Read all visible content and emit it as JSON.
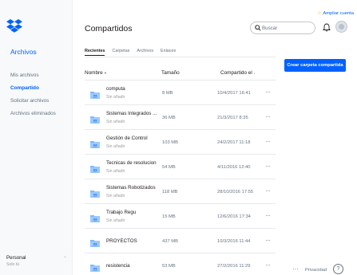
{
  "sidebar": {
    "title": "Archivos",
    "items": [
      {
        "label": "Mis archivos"
      },
      {
        "label": "Compartido"
      },
      {
        "label": "Solicitar archivos"
      },
      {
        "label": "Archivos eliminados"
      }
    ],
    "account": {
      "name": "Personal",
      "sub": "Solo tú"
    }
  },
  "header": {
    "title": "Compartidos",
    "upgrade_label": "Ampliar cuenta",
    "search_placeholder": "Buscar"
  },
  "tabs": [
    {
      "label": "Recientes",
      "active": true
    },
    {
      "label": "Carpetas"
    },
    {
      "label": "Archivos"
    },
    {
      "label": "Enlaces"
    }
  ],
  "create_button": "Crear carpeta compartida",
  "table": {
    "columns": {
      "name": "Nombre",
      "name_sort": "▾",
      "size": "Tamaño",
      "shared": "Compartido el",
      "shared_sort": "↓"
    },
    "rows": [
      {
        "name": "computa",
        "sub": "Sin añadir",
        "size": "8 MB",
        "date": "10/4/2017 16:41"
      },
      {
        "name": "Sistemas Integrados ...",
        "sub": "Sin añadir",
        "size": "36 MB",
        "date": "21/3/2017 8:35"
      },
      {
        "name": "Gestión de Control",
        "sub": "Sin añadir",
        "size": "103 MB",
        "date": "24/2/2017 11:18"
      },
      {
        "name": "Tecnicas de resolucion",
        "sub": "Sin añadir",
        "size": "54 MB",
        "date": "4/11/2016 12:40"
      },
      {
        "name": "Sistemas Robotizados",
        "sub": "Sin añadir",
        "size": "118 MB",
        "date": "28/10/2016 17:55"
      },
      {
        "name": "Trabajo Regu",
        "sub": "Sin añadir",
        "size": "15 MB",
        "date": "12/6/2016 17:34"
      },
      {
        "name": "PROYECTOS",
        "sub": "",
        "size": "437 MB",
        "date": "10/3/2016 11:44"
      },
      {
        "name": "resistencia",
        "sub": "",
        "size": "53 MB",
        "date": "27/2/2016 11:29"
      }
    ],
    "more_label": "···"
  },
  "footer": {
    "more_label": "···",
    "privacy": "Privacidad",
    "help": "?"
  },
  "colors": {
    "accent": "#0061fe",
    "folder": "#7fb8ff",
    "sidebar_bg": "#f7f9fa"
  },
  "icons": {
    "logo": "dropbox-logo-icon",
    "search": "search-icon",
    "bell": "bell-icon",
    "folder": "shared-folder-icon",
    "help": "help-icon",
    "star": "star-icon"
  }
}
